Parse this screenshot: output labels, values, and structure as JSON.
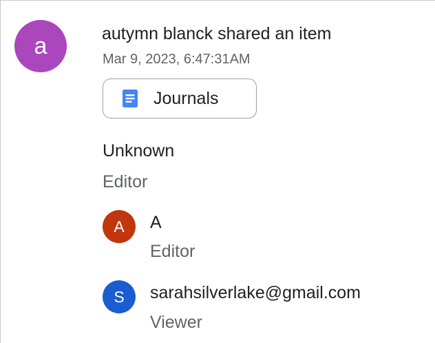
{
  "activity": {
    "actor_initial": "a",
    "actor_avatar_color": "#ab47bc",
    "headline": "autymn blanck shared an item",
    "timestamp": "Mar 9, 2023, 6:47:31AM",
    "item": {
      "label": "Journals",
      "icon": "google-docs-icon",
      "icon_color": "#4285f4"
    },
    "permissions": {
      "general": {
        "name": "Unknown",
        "role": "Editor"
      },
      "users": [
        {
          "initial": "A",
          "name": "A",
          "role": "Editor",
          "avatar_color": "#c1360d"
        },
        {
          "initial": "S",
          "name": "sarahsilverlake@gmail.com",
          "role": "Viewer",
          "avatar_color": "#1a5dd0"
        }
      ]
    }
  }
}
